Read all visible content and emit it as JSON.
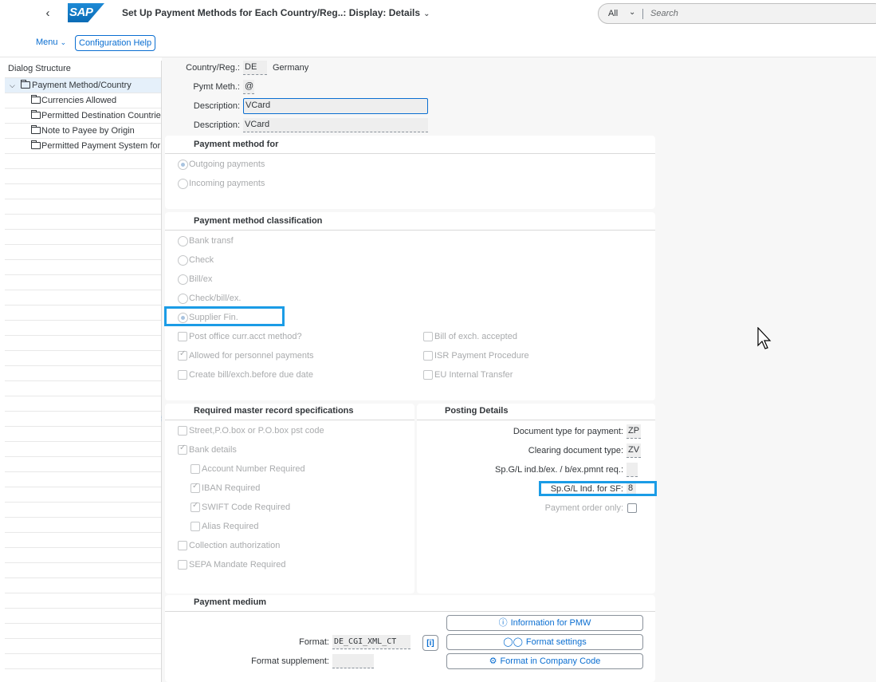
{
  "shell": {
    "back_icon": "chevron-left-icon",
    "logo_text": "SAP",
    "title": "Set Up Payment Methods for Each Country/Reg..: Display: Details",
    "search": {
      "scope": "All",
      "placeholder": "Search"
    }
  },
  "toolbar": {
    "menu_label": "Menu",
    "config_help_label": "Configuration Help"
  },
  "tree": {
    "header": "Dialog Structure",
    "items": [
      {
        "label": "Payment Method/Country",
        "selected": true
      },
      {
        "label": "Currencies Allowed"
      },
      {
        "label": "Permitted Destination Countries"
      },
      {
        "label": "Note to Payee by Origin"
      },
      {
        "label": "Permitted Payment System for P"
      }
    ]
  },
  "header_fields": {
    "country_label": "Country/Reg.:",
    "country_value": "DE",
    "country_text": "Germany",
    "pymt_meth_label": "Pymt Meth.:",
    "pymt_meth_value": "@",
    "description_label": "Description:",
    "description_value": "VCard",
    "description2_label": "Description:",
    "description2_value": "VCard"
  },
  "payment_method_for": {
    "title": "Payment method for",
    "outgoing": "Outgoing payments",
    "incoming": "Incoming payments"
  },
  "classification": {
    "title": "Payment method classification",
    "bank_transf": "Bank transf",
    "check": "Check",
    "bill_ex": "Bill/ex",
    "check_bill_ex": "Check/bill/ex.",
    "supplier_fin": "Supplier Fin.",
    "post_office": "Post office curr.acct method?",
    "personnel": "Allowed for personnel payments",
    "create_bill": "Create bill/exch.before due date",
    "bill_accepted": "Bill of exch. accepted",
    "isr": "ISR Payment Procedure",
    "eu_transfer": "EU Internal Transfer"
  },
  "master_record": {
    "title": "Required master record specifications",
    "street": "Street,P.O.box or P.O.box pst code",
    "bank_details": "Bank details",
    "account_number": "Account Number Required",
    "iban": "IBAN Required",
    "swift": "SWIFT Code Required",
    "alias": "Alias Required",
    "collection": "Collection authorization",
    "sepa": "SEPA Mandate Required"
  },
  "posting": {
    "title": "Posting Details",
    "doc_type_label": "Document type for payment:",
    "doc_type_value": "ZP",
    "clearing_label": "Clearing document type:",
    "clearing_value": "ZV",
    "spgl_label": "Sp.G/L ind.b/ex. / b/ex.pmnt req.:",
    "spgl_value": "",
    "spgl_sf_label": "Sp.G/L Ind. for SF:",
    "spgl_sf_value": "8",
    "payment_order_label": "Payment order only:"
  },
  "medium": {
    "title": "Payment medium",
    "format_label": "Format:",
    "format_value": "DE_CGI_XML_CT",
    "format_supp_label": "Format supplement:",
    "format_supp_value": "",
    "info_btn": "Information for PMW",
    "settings_btn": "Format settings",
    "company_btn": "Format in Company Code"
  },
  "colors": {
    "accent": "#0a6ed1",
    "highlight": "#1b9ce6"
  }
}
